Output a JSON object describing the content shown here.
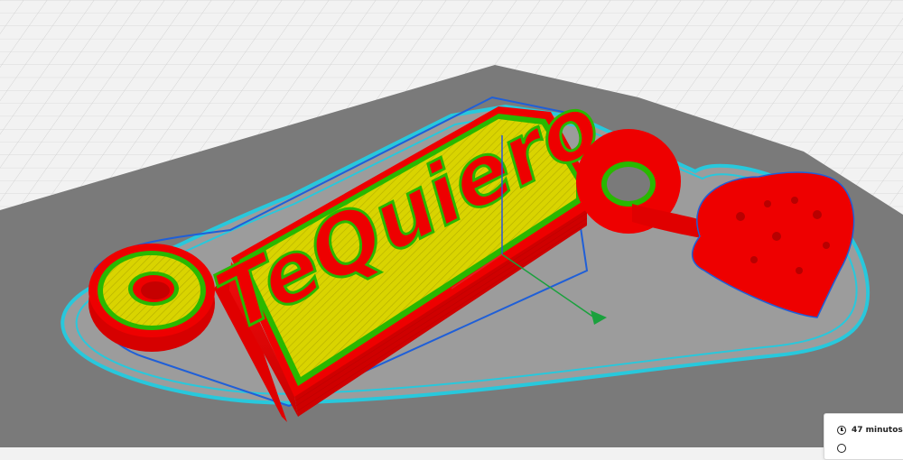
{
  "viewer": {
    "model_text": "TeQuiero",
    "colors": {
      "background": "#f2f2f2",
      "grid_line": "#cfcfcf",
      "build_plate": "#7a7a7a",
      "brim_outline": "#28c8dc",
      "outer_wall": "#ee0000",
      "inner_wall": "#29b800",
      "infill": "#d9d400",
      "model_outline": "#1f5fd8",
      "axis_x": "#e02424",
      "axis_y": "#1aa13d",
      "axis_z": "#2a54d8"
    },
    "icons": [
      "clock-icon",
      "arrow-icon"
    ]
  },
  "estimate": {
    "time": "47 minutos",
    "second_line": ""
  }
}
